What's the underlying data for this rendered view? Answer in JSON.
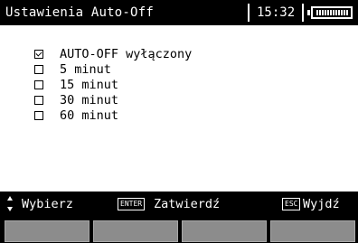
{
  "header": {
    "title": "Ustawienia Auto-Off",
    "time": "15:32",
    "battery_level": 1.0
  },
  "options": [
    {
      "label": "AUTO-OFF wyłączony",
      "checked": true
    },
    {
      "label": "5 minut",
      "checked": false
    },
    {
      "label": "15 minut",
      "checked": false
    },
    {
      "label": "30 minut",
      "checked": false
    },
    {
      "label": "60 minut",
      "checked": false
    }
  ],
  "footer": {
    "select_icon": "up-down-arrows-icon",
    "select_label": "Wybierz",
    "enter_key": "ENTER",
    "enter_label": "Zatwierdź",
    "esc_key": "ESC",
    "esc_label": "Wyjdź"
  },
  "softkeys": [
    "",
    "",
    "",
    ""
  ],
  "colors": {
    "background": "#ffffff",
    "bar": "#000000",
    "softkey": "#8c8c8c"
  }
}
